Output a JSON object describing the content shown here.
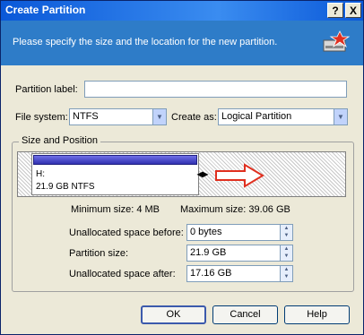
{
  "window": {
    "title": "Create Partition",
    "help_button": "?",
    "close_button": "X"
  },
  "banner": {
    "text": "Please specify the size and the location for the new partition."
  },
  "form": {
    "partition_label": {
      "label": "Partition label:",
      "value": ""
    },
    "file_system": {
      "label": "File system:",
      "value": "NTFS"
    },
    "create_as": {
      "label": "Create as:",
      "value": "Logical Partition"
    }
  },
  "size_position": {
    "group_title": "Size and Position",
    "partition_name": "H:",
    "partition_info": "21.9 GB  NTFS",
    "minimum_size": "Minimum size: 4 MB",
    "maximum_size": "Maximum size: 39.06 GB",
    "unallocated_before": {
      "label": "Unallocated space before:",
      "value": "0 bytes"
    },
    "partition_size": {
      "label": "Partition size:",
      "value": "21.9 GB"
    },
    "unallocated_after": {
      "label": "Unallocated space after:",
      "value": "17.16 GB"
    }
  },
  "buttons": {
    "ok": "OK",
    "cancel": "Cancel",
    "help": "Help"
  }
}
